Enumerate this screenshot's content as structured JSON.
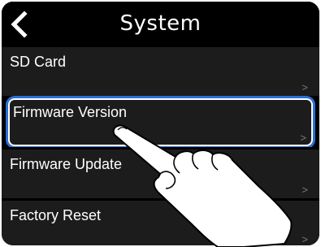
{
  "header": {
    "title": "System",
    "back_icon": "chevron-left-icon"
  },
  "menu": [
    {
      "label": "SD Card",
      "chevron": ">"
    },
    {
      "label": "Firmware Version",
      "chevron": ">",
      "selected": true
    },
    {
      "label": "Firmware Update",
      "chevron": ">"
    },
    {
      "label": "Factory Reset",
      "chevron": ">"
    }
  ],
  "colors": {
    "screen": "#000000",
    "row": "#1c1c1c",
    "text": "#ffffff",
    "highlight": "#2a6fd6",
    "chevron": "#7a7a7a"
  },
  "overlay": {
    "icon": "pointing-hand-icon"
  }
}
